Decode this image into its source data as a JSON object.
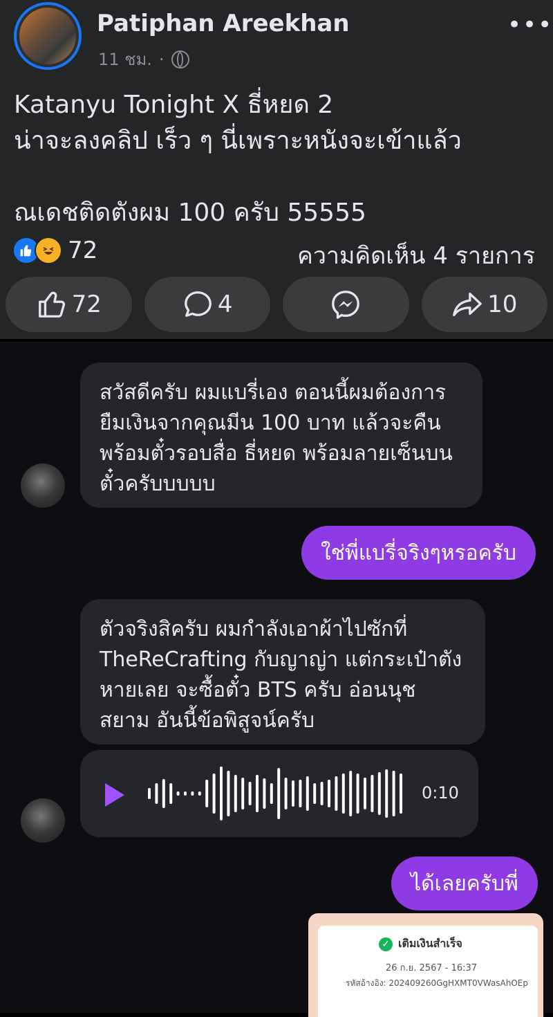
{
  "post": {
    "author": "Patiphan Areekhan",
    "time": "11 ชม.",
    "separator": "·",
    "privacy_icon": "globe-icon",
    "more_icon": "•••",
    "text": "Katanyu Tonight X ธี่หยด 2\nน่าจะลงคลิป เร็ว ๆ นี่เพราะหนังจะเข้าแล้ว\n\nณเดชติดตังผม 100 ครับ 55555",
    "reaction_count": "72",
    "comment_summary": "ความคิดเห็น 4 รายการ",
    "actions": {
      "like_count": "72",
      "comment_count": "4",
      "share_count": "10"
    }
  },
  "chat": {
    "messages": [
      {
        "from": "them",
        "text": "สวัสดีครับ ผมแบรี่เอง ตอนนี้ผมต้องการ\nยืมเงินจากคุณมีน 100 บาท แล้วจะคืน\nพร้อมตั๋วรอบสื่อ ธี่หยด พร้อมลายเซ็นบน\nตั๋วครับบบบบ"
      },
      {
        "from": "me",
        "text": "ใช่พี่แบรี่จริงๆหรอครับ"
      },
      {
        "from": "them",
        "text": "ตัวจริงสิครับ ผมกำลังเอาผ้าไปซักที่\nTheReCrafting กับญาญ่า แต่กระเป๋าตัง\nหายเลย จะซื้อตั๋ว BTS ครับ อ่อนนุช\nสยาม อันนี้ข้อพิสูจน์ครับ"
      },
      {
        "from": "them",
        "type": "voice",
        "duration": "0:10"
      },
      {
        "from": "me",
        "text": "ได้เลยครับพี่"
      }
    ],
    "receipt": {
      "status": "เติมเงินสำเร็จ",
      "datetime": "26 ก.ย. 2567 - 16:37",
      "reference": "รหัสอ้างอิง: 202409260GgHXMT0VWasAhOEp"
    }
  },
  "colors": {
    "post_bg": "#242526",
    "chat_bg": "#0d0d12",
    "incoming_bubble": "#25252c",
    "outgoing_bubble": "#8e3be6",
    "accent_blue": "#1877f2"
  }
}
